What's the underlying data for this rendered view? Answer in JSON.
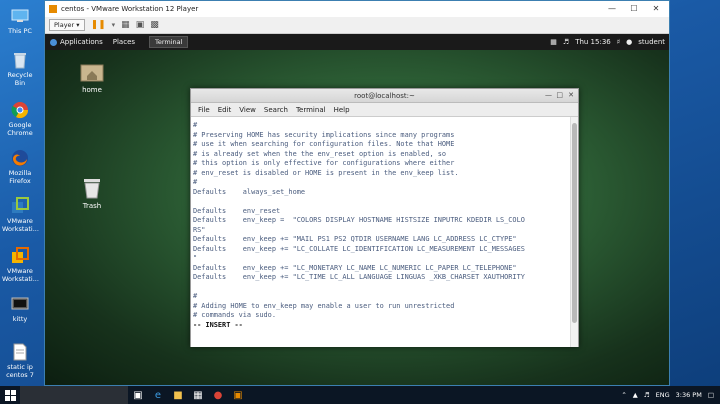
{
  "desktop_icons": [
    {
      "label": "This PC",
      "icon": "computer-icon"
    },
    {
      "label": "Recycle Bin",
      "icon": "recycle-bin-icon"
    },
    {
      "label": "Google Chrome",
      "icon": "chrome-icon"
    },
    {
      "label": "Mozilla Firefox",
      "icon": "firefox-icon"
    },
    {
      "label": "VMware Workstati...",
      "icon": "vmware-icon"
    },
    {
      "label": "VMware Workstati...",
      "icon": "vmware-icon"
    },
    {
      "label": "kitty",
      "icon": "kitty-icon"
    },
    {
      "label": "static ip centos 7",
      "icon": "document-icon"
    }
  ],
  "vmware": {
    "title": "centos - VMware Workstation 12 Player",
    "player_button": "Player ▾"
  },
  "gnome": {
    "applications": "Applications",
    "places": "Places",
    "terminal_task": "Terminal",
    "time": "Thu 15:36",
    "user": "student"
  },
  "guest_icons": [
    {
      "label": "home",
      "icon": "home-folder-icon"
    },
    {
      "label": "Trash",
      "icon": "trash-icon"
    }
  ],
  "terminal": {
    "title": "root@localhost:~",
    "menu": [
      "File",
      "Edit",
      "View",
      "Search",
      "Terminal",
      "Help"
    ],
    "lines": [
      "#",
      "# Preserving HOME has security implications since many programs",
      "# use it when searching for configuration files. Note that HOME",
      "# is already set when the the env_reset option is enabled, so",
      "# this option is only effective for configurations where either",
      "# env_reset is disabled or HOME is present in the env_keep list.",
      "#",
      "Defaults    always_set_home",
      "",
      "Defaults    env_reset",
      "Defaults    env_keep =  \"COLORS DISPLAY HOSTNAME HISTSIZE INPUTRC KDEDIR LS_COLO",
      "RS\"",
      "Defaults    env_keep += \"MAIL PS1 PS2 QTDIR USERNAME LANG LC_ADDRESS LC_CTYPE\"",
      "Defaults    env_keep += \"LC_COLLATE LC_IDENTIFICATION LC_MEASUREMENT LC_MESSAGES",
      "\"",
      "Defaults    env_keep += \"LC_MONETARY LC_NAME LC_NUMERIC LC_PAPER LC_TELEPHONE\"",
      "Defaults    env_keep += \"LC_TIME LC_ALL LANGUAGE LINGUAS _XKB_CHARSET XAUTHORITY",
      "",
      "#",
      "# Adding HOME to env_keep may enable a user to run unrestricted",
      "# commands via sudo.",
      "-- INSERT --"
    ]
  },
  "taskbar": {
    "search_placeholder": "",
    "time": "3:36 PM",
    "language": "ENG"
  }
}
